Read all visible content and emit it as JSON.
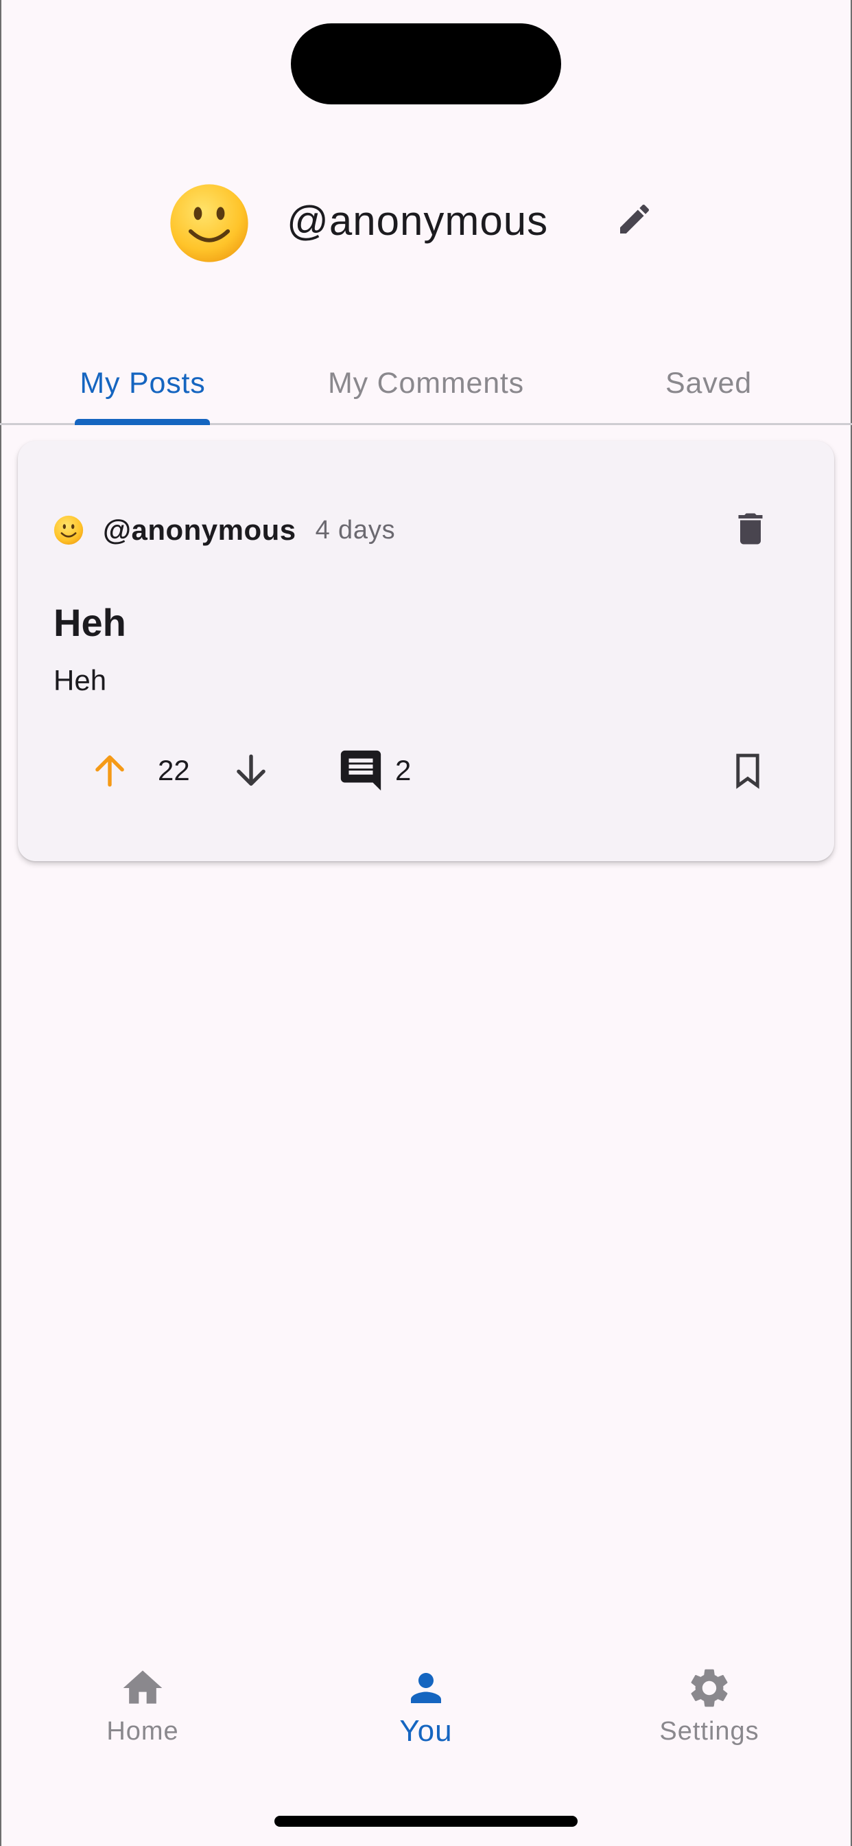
{
  "profile": {
    "username": "@anonymous",
    "avatar_icon": "slightly-smiling-face-emoji",
    "edit_icon": "pencil-icon"
  },
  "tabs": [
    {
      "label": "My Posts",
      "active": true
    },
    {
      "label": "My Comments",
      "active": false
    },
    {
      "label": "Saved",
      "active": false
    }
  ],
  "post": {
    "author": "@anonymous",
    "time": "4 days",
    "title": "Heh",
    "body": "Heh",
    "upvotes": "22",
    "comments": "2",
    "icons": {
      "delete": "trash-icon",
      "upvote": "arrow-up-icon",
      "downvote": "arrow-down-icon",
      "comment": "comment-icon",
      "save": "bookmark-icon"
    }
  },
  "nav": {
    "home": "Home",
    "you": "You",
    "settings": "Settings"
  },
  "colors": {
    "accent": "#1565c0",
    "upvote": "#f59a16",
    "background": "#fdf7fb",
    "card": "#f6f2f7"
  }
}
